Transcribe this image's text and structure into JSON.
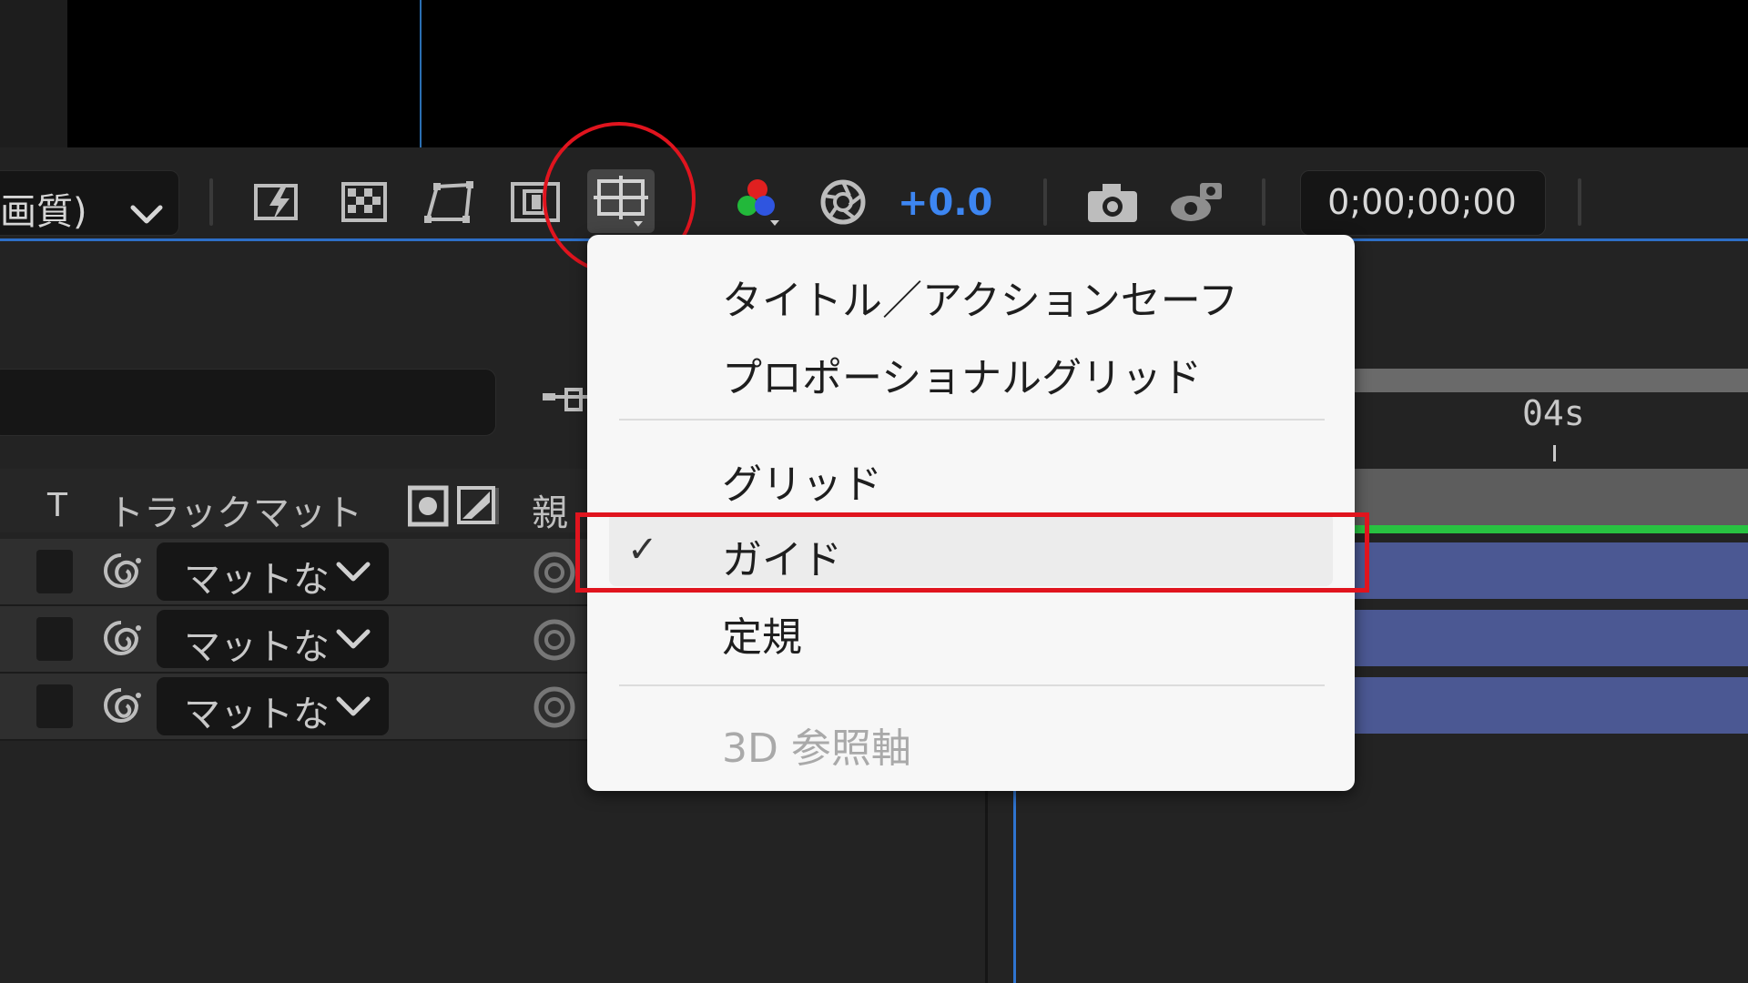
{
  "toolbar": {
    "quality_label": "画質)",
    "exposure_value": "+0.0",
    "timecode": "0;00;00;00",
    "icons": [
      "fast-previews-icon",
      "transparency-grid-icon",
      "mask-path-icon",
      "region-of-interest-icon",
      "grid-guide-options-icon",
      "show-channel-icon",
      "reset-exposure-icon",
      "snapshot-icon",
      "show-snapshot-icon"
    ]
  },
  "timeline": {
    "columns": {
      "t": "T",
      "track_matte": "トラックマット",
      "parent": "親"
    },
    "rows": [
      {
        "matte": "マットな"
      },
      {
        "matte": "マットな"
      },
      {
        "matte": "マットな"
      }
    ],
    "ruler_label": "04s"
  },
  "menu": {
    "items": [
      {
        "label": "タイトル／アクションセーフ",
        "checked": false,
        "enabled": true
      },
      {
        "label": "プロポーショナルグリッド",
        "checked": false,
        "enabled": true
      },
      {
        "label": "グリッド",
        "checked": false,
        "enabled": true
      },
      {
        "label": "ガイド",
        "checked": true,
        "enabled": true
      },
      {
        "label": "定規",
        "checked": false,
        "enabled": true
      },
      {
        "label": "3D 参照軸",
        "checked": false,
        "enabled": false
      }
    ],
    "check_mark": "✓"
  },
  "colors": {
    "accent_blue": "#2d6fc7",
    "exposure_blue": "#3d86f2",
    "highlight_red": "#e0141e",
    "layer_bar": "#4b5893",
    "work_area_green": "#28c241"
  }
}
